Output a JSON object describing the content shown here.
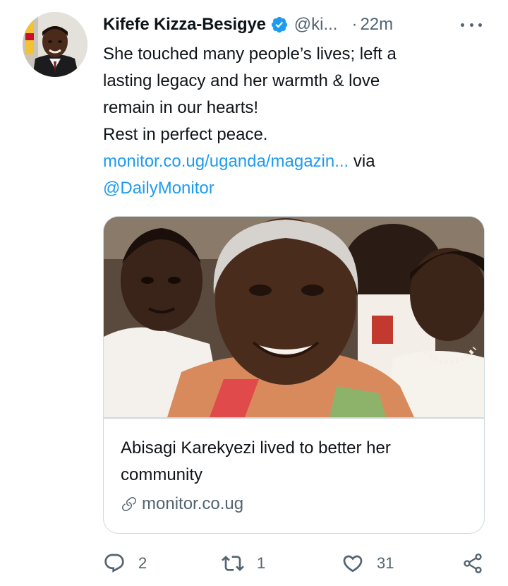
{
  "tweet": {
    "author_name": "Kifefe Kizza-Besigye",
    "handle": "@ki...",
    "separator": "·",
    "time": "22m",
    "text_lines": [
      "She touched many people’s lives; left a",
      "lasting legacy and her warmth & love",
      "remain in our hearts!",
      "Rest in perfect peace."
    ],
    "link_text": "monitor.co.ug/uganda/magazin...",
    "via_text": " via",
    "mention": "@DailyMonitor"
  },
  "card": {
    "title": "Abisagi Karekyezi lived to better her community",
    "domain": "monitor.co.ug"
  },
  "actions": {
    "replies": "2",
    "retweets": "1",
    "likes": "31"
  },
  "colors": {
    "accent": "#1d9bf0",
    "secondary_text": "#536471",
    "border": "#cfd9de"
  },
  "icons": [
    "verified-badge-icon",
    "more-icon",
    "link-icon",
    "reply-icon",
    "retweet-icon",
    "like-icon",
    "share-icon"
  ]
}
